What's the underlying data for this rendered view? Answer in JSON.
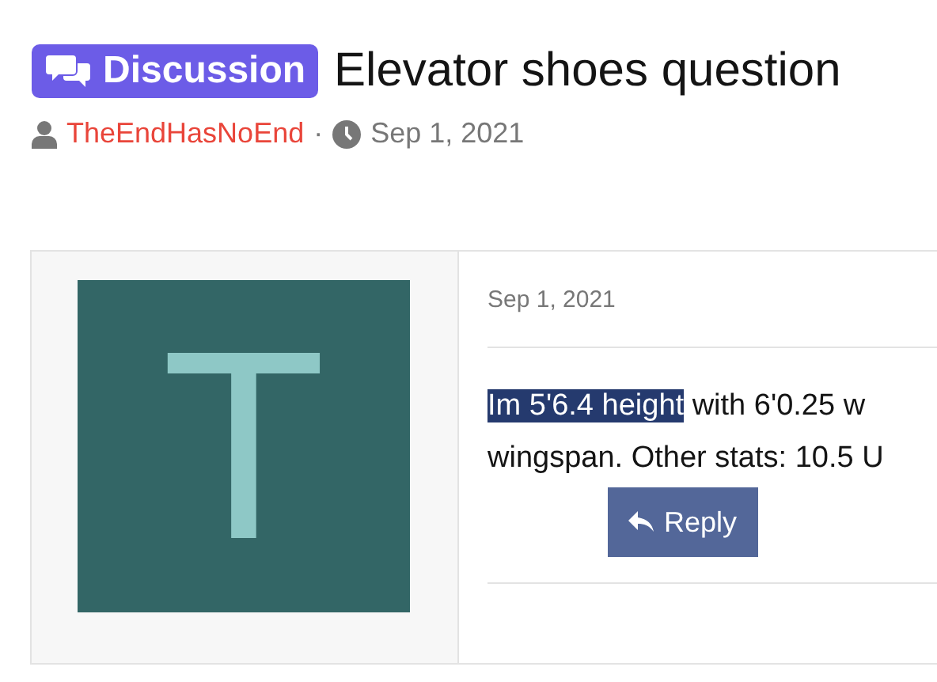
{
  "thread": {
    "prefix": "Discussion",
    "title": "Elevator shoes question",
    "author": "TheEndHasNoEnd",
    "separator": "·",
    "date": "Sep 1, 2021"
  },
  "post": {
    "avatar_letter": "T",
    "date": "Sep 1, 2021",
    "lines": [
      {
        "selected_part": "Im 5'6.4 height",
        "rest": " with 6'0.25 w"
      },
      {
        "rest": "wingspan. Other stats: 10.5 U"
      }
    ],
    "reply_button": "Reply"
  }
}
